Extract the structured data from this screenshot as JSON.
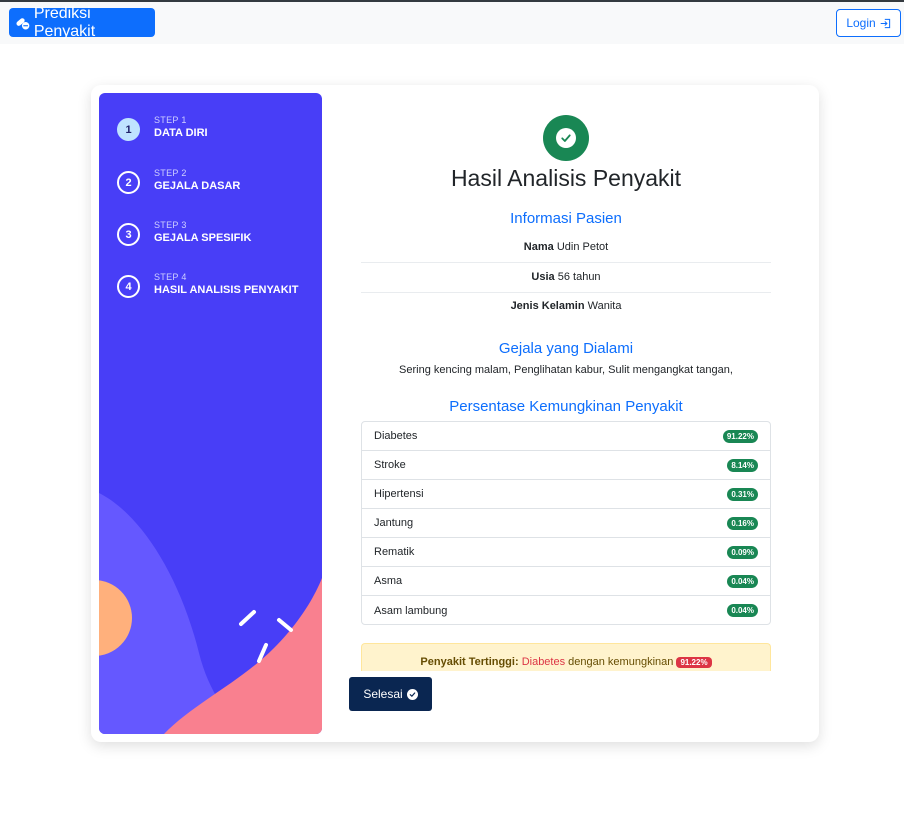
{
  "navbar": {
    "brand": "Prediksi Penyakit",
    "login_label": "Login"
  },
  "steps": [
    {
      "num": "1",
      "small": "STEP 1",
      "name": "DATA DIRI"
    },
    {
      "num": "2",
      "small": "STEP 2",
      "name": "GEJALA DASAR"
    },
    {
      "num": "3",
      "small": "STEP 3",
      "name": "GEJALA SPESIFIK"
    },
    {
      "num": "4",
      "small": "STEP 4",
      "name": "HASIL ANALISIS PENYAKIT"
    }
  ],
  "result": {
    "title": "Hasil Analisis Penyakit",
    "patient_heading": "Informasi Pasien",
    "patient": [
      {
        "label": "Nama",
        "value": "Udin Petot"
      },
      {
        "label": "Usia",
        "value": "56 tahun"
      },
      {
        "label": "Jenis Kelamin",
        "value": "Wanita"
      }
    ],
    "symptoms_heading": "Gejala yang Dialami",
    "symptoms": "Sering kencing malam, Penglihatan kabur, Sulit mengangkat tangan,",
    "percent_heading": "Persentase Kemungkinan Penyakit",
    "diseases": [
      {
        "name": "Diabetes",
        "percent": "91.22%"
      },
      {
        "name": "Stroke",
        "percent": "8.14%"
      },
      {
        "name": "Hipertensi",
        "percent": "0.31%"
      },
      {
        "name": "Jantung",
        "percent": "0.16%"
      },
      {
        "name": "Rematik",
        "percent": "0.09%"
      },
      {
        "name": "Asma",
        "percent": "0.04%"
      },
      {
        "name": "Asam lambung",
        "percent": "0.04%"
      }
    ],
    "top_label": "Penyakit Tertinggi:",
    "top_disease": "Diabetes",
    "top_middle": "dengan kemungkinan",
    "top_percent": "91.22%",
    "finish_label": "Selesai"
  },
  "colors": {
    "primary": "#0d6efd",
    "sidebar": "#483ef7",
    "success": "#198754",
    "danger": "#dc3545",
    "button_dark": "#0a2651"
  }
}
